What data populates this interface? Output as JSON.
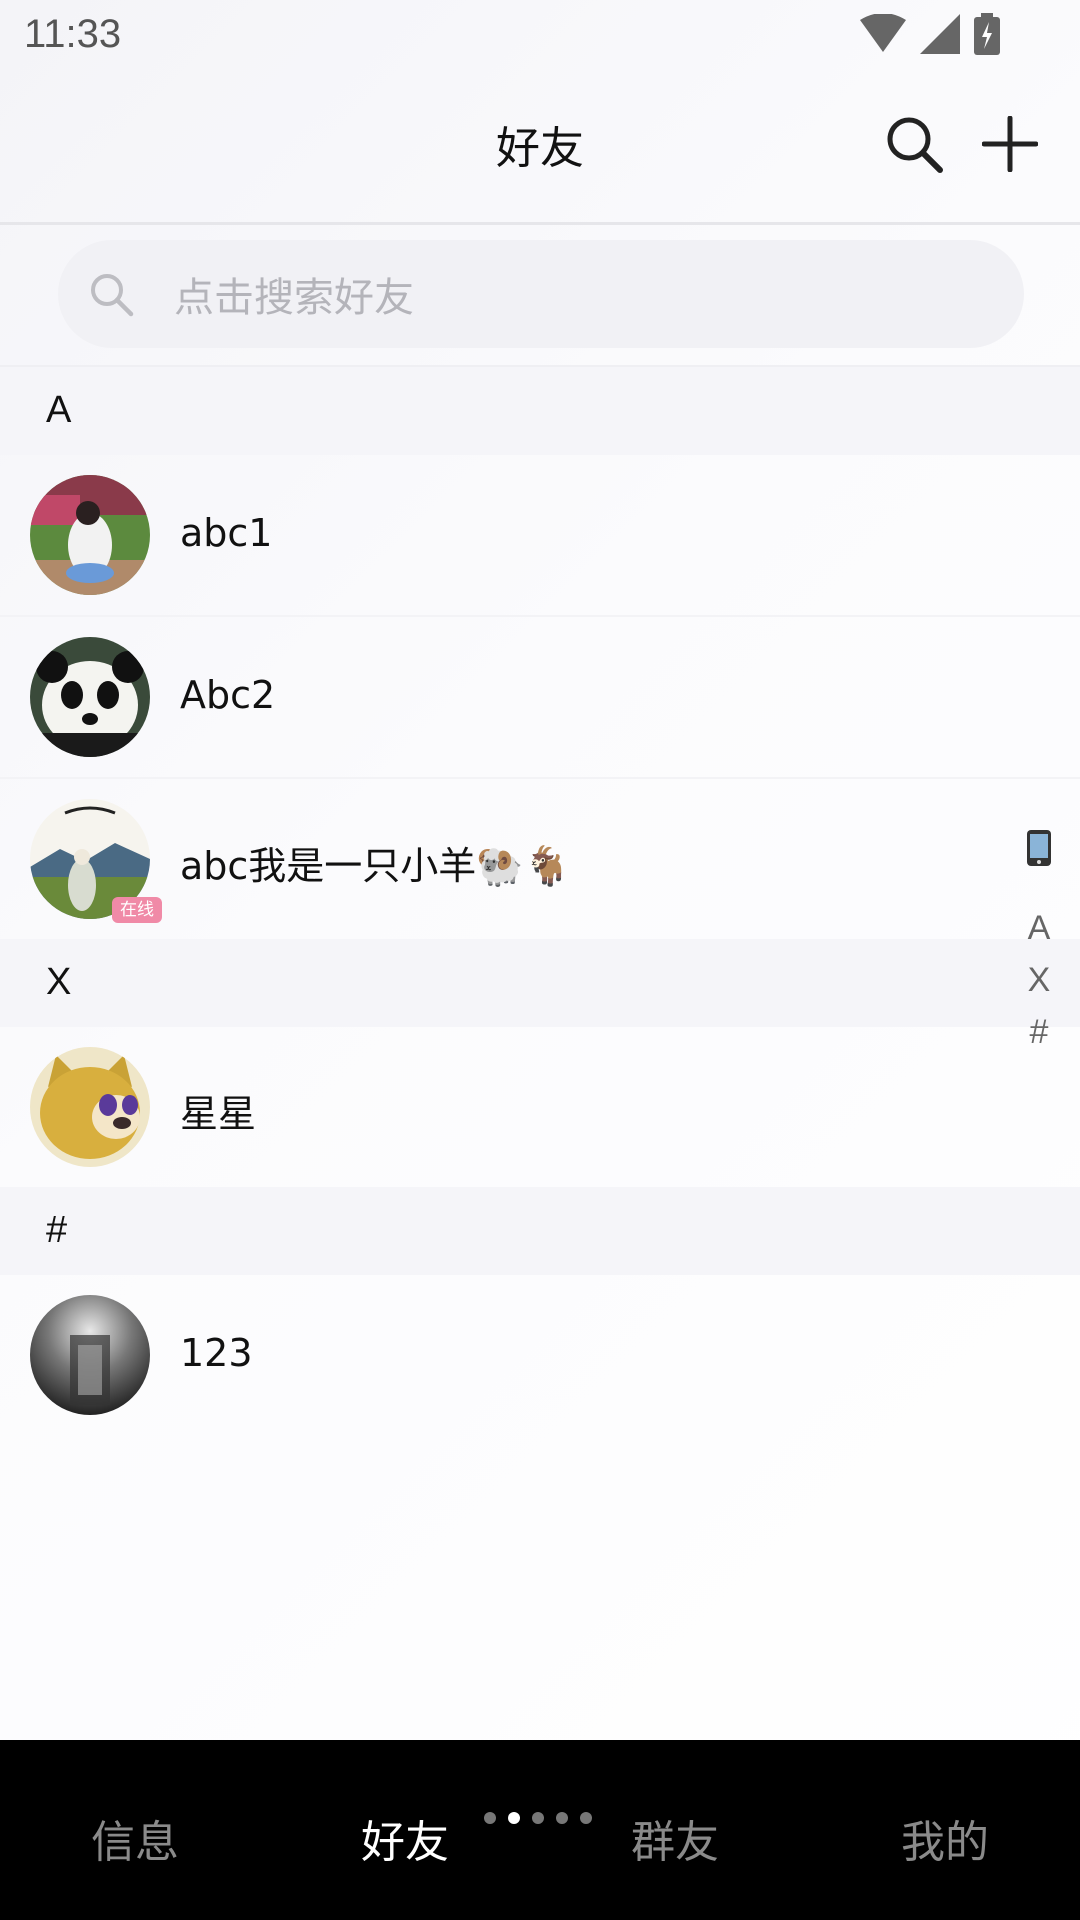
{
  "status_bar": {
    "time": "11:33"
  },
  "header": {
    "title": "好友",
    "search_icon": "search-icon",
    "add_icon": "plus-icon"
  },
  "search": {
    "placeholder": "点击搜索好友"
  },
  "sections": [
    {
      "letter": "A",
      "contacts": [
        {
          "name": "abc1",
          "online": false
        },
        {
          "name": "Abc2",
          "online": false
        },
        {
          "name": "abc我是一只小羊🐏🐐",
          "online": true,
          "badge": "在线"
        }
      ]
    },
    {
      "letter": "X",
      "contacts": [
        {
          "name": "星星",
          "online": false
        }
      ]
    },
    {
      "letter": "#",
      "contacts": [
        {
          "name": "123",
          "online": false
        }
      ]
    }
  ],
  "index_bar": {
    "icon": "phone-icon",
    "letters": [
      "A",
      "X",
      "#"
    ]
  },
  "bottom_nav": {
    "tabs": [
      "信息",
      "好友",
      "群友",
      "我的"
    ],
    "active_index": 1,
    "pager_dots": 5,
    "active_dot": 1
  },
  "colors": {
    "online_badge": "#f08aa7",
    "nav_bg": "#000000",
    "section_bg": "#f5f5f9"
  }
}
